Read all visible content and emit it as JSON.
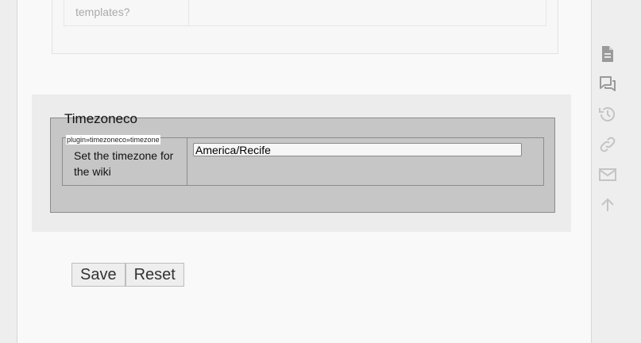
{
  "previous_section": {
    "label": "templates?"
  },
  "timezone_section": {
    "legend": "Timezoneco",
    "plugin_key": "plugin»timezoneco»timezone",
    "label": "Set the timezone for the wiki",
    "value": "America/Recife"
  },
  "actions": {
    "save_label": "Save",
    "reset_label": "Reset"
  },
  "toolbar": {
    "items": [
      "document-icon",
      "discussion-icon",
      "history-icon",
      "link-icon",
      "mail-icon",
      "arrow-up-icon"
    ]
  },
  "colors": {
    "fieldset_bg": "#c6c6c6",
    "icon": "#9a9a9a"
  }
}
